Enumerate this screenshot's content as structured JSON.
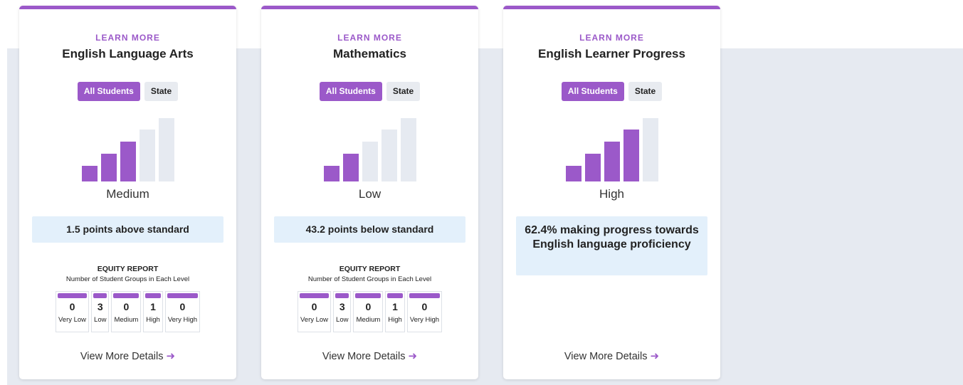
{
  "cards": [
    {
      "learn_more": "LEARN MORE",
      "title": "English Language Arts",
      "toggle_active": "All Students",
      "toggle_inactive": "State",
      "level_bars_filled": 3,
      "level": "Medium",
      "status": "1.5 points above standard",
      "equity": {
        "title": "EQUITY REPORT",
        "subtitle": "Number of Student Groups in Each Level",
        "cells": [
          {
            "count": "0",
            "label": "Very Low"
          },
          {
            "count": "3",
            "label": "Low"
          },
          {
            "count": "0",
            "label": "Medium"
          },
          {
            "count": "1",
            "label": "High"
          },
          {
            "count": "0",
            "label": "Very High"
          }
        ]
      },
      "view_more": "View More Details",
      "view_more_icon": "arrow-right-icon"
    },
    {
      "learn_more": "LEARN MORE",
      "title": "Mathematics",
      "toggle_active": "All Students",
      "toggle_inactive": "State",
      "level_bars_filled": 2,
      "level": "Low",
      "status": "43.2 points below standard",
      "equity": {
        "title": "EQUITY REPORT",
        "subtitle": "Number of Student Groups in Each Level",
        "cells": [
          {
            "count": "0",
            "label": "Very Low"
          },
          {
            "count": "3",
            "label": "Low"
          },
          {
            "count": "0",
            "label": "Medium"
          },
          {
            "count": "1",
            "label": "High"
          },
          {
            "count": "0",
            "label": "Very High"
          }
        ]
      },
      "view_more": "View More Details",
      "view_more_icon": "arrow-right-icon"
    },
    {
      "learn_more": "LEARN MORE",
      "title": "English Learner Progress",
      "toggle_active": "All Students",
      "toggle_inactive": "State",
      "level_bars_filled": 4,
      "level": "High",
      "status": "62.4% making progress towards English language proficiency",
      "view_more": "View More Details",
      "view_more_icon": "arrow-right-icon"
    }
  ],
  "colors": {
    "accent": "#9b59c9",
    "status_bg": "#e3f0fb",
    "page_band": "#e6eaf1",
    "bar_inactive": "#e6eaf1"
  }
}
